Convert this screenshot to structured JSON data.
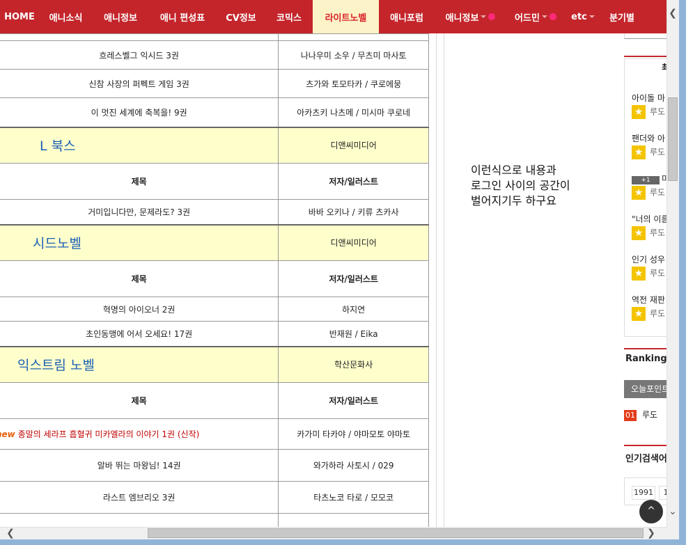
{
  "nav": {
    "items": [
      {
        "label": "HOME",
        "width": 56
      },
      {
        "label": "애니소식",
        "width": 77
      },
      {
        "label": "애니정보",
        "width": 80
      },
      {
        "label": "애니 편성표",
        "width": 98
      },
      {
        "label": "CV정보",
        "width": 70
      },
      {
        "label": "코믹스",
        "width": 68
      },
      {
        "label": "라이트노벨",
        "width": 95,
        "active": true
      },
      {
        "label": "애니포럼",
        "width": 80
      },
      {
        "label": "애니정보",
        "width": 103,
        "caret": true,
        "dot": true
      },
      {
        "label": "어드민",
        "width": 84,
        "caret": true,
        "dot": true
      },
      {
        "label": "etc",
        "width": 52,
        "caret": true
      },
      {
        "label": "분기별",
        "width": 60
      }
    ]
  },
  "table": {
    "top_rows": [
      {
        "title": "흐레스벨그 익시드 3권",
        "author": "나나우미 소우 / 무츠미 마사토"
      },
      {
        "title": "신참 사장의 퍼펙트 게임 3권",
        "author": "츠가와 토모타카 / 쿠로에뭉"
      },
      {
        "title": "이 멋진 세계에 축복을! 9권",
        "author": "아카츠키 나츠메 / 미시마 쿠로네"
      }
    ],
    "header": {
      "title": "제목",
      "author": "저자/일러스트"
    },
    "sections": [
      {
        "publisher_name": "L 북스",
        "label": "디앤씨미디어",
        "rows": [
          {
            "title": "거미입니다만, 문제라도? 3권",
            "author": "바바 오키나 / 키류 츠카사"
          }
        ]
      },
      {
        "publisher_name": "시드노벨",
        "label": "디앤씨미디어",
        "rows": [
          {
            "title": "혁명의 아이오너 2권",
            "author": "하지연"
          },
          {
            "title": "초인동맹에 어서 오세요! 17권",
            "author": "반재원 / Eika"
          }
        ]
      },
      {
        "publisher_name": "익스트림 노벨",
        "label": "학산문화사",
        "rows": [
          {
            "new": "new",
            "title": "종말의 세라프 흡혈귀 미카엘라의 이야기 1권 (신작)",
            "author": "카가미 타카야 / 야마모토 야마토"
          },
          {
            "title": "알바 뛰는 마왕님! 14권",
            "author": "와가하라 사토시 /  029"
          },
          {
            "title": "라스트 엠브리오 3권",
            "author": "타츠노코 타로 / 모모코"
          }
        ]
      }
    ]
  },
  "comment": {
    "lines": [
      "이런식으로 내용과",
      "로그인 사이의 공간이",
      "벌어지기두 하구요"
    ]
  },
  "sidebar": {
    "heading_fragment": "최",
    "items": [
      {
        "text": "아이돌 마",
        "sub": "루도"
      },
      {
        "text": "팬더와 아",
        "sub": "루도"
      },
      {
        "text": "미",
        "badge": "+1",
        "sub": "루도"
      },
      {
        "text": "\"너의 이름",
        "sub": "루도"
      },
      {
        "text": "인기 성우",
        "sub": "루도"
      },
      {
        "text": "역전 재판",
        "sub": "루도"
      }
    ],
    "ranking_title": "Ranking",
    "ranking_tab": "오늘포인트",
    "ranking_items": [
      {
        "num": "01",
        "name": "루도"
      }
    ],
    "search_title": "인기검색어",
    "search_chips": [
      "1991",
      "1"
    ]
  },
  "scroll_top_label": "^"
}
